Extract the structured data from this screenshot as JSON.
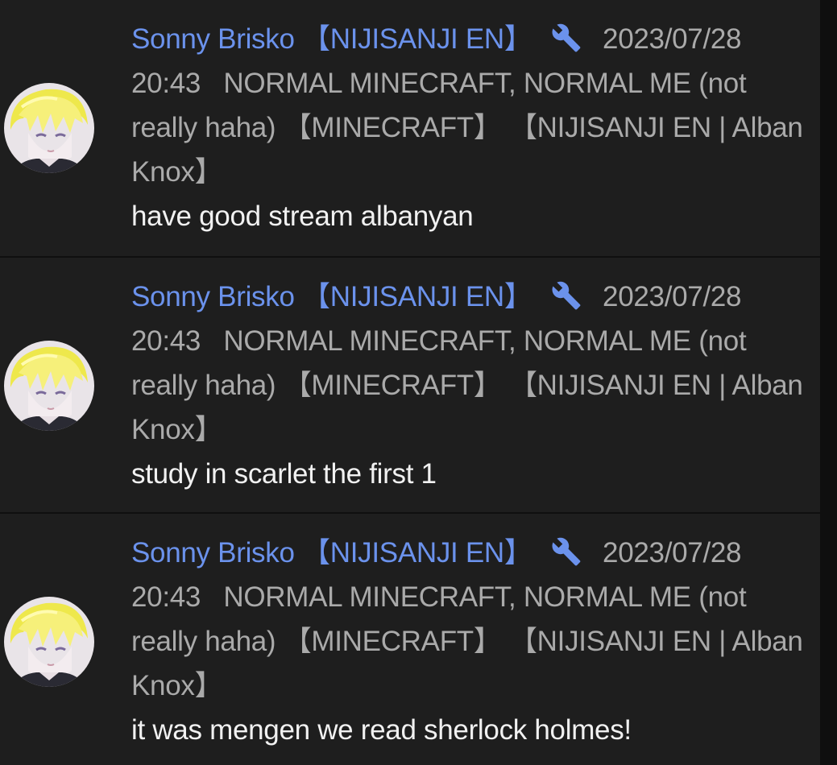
{
  "comments": [
    {
      "author": "Sonny Brisko",
      "affiliation": "【NIJISANJI EN】",
      "date": "2023/07/28",
      "time": "20:43",
      "title_line1": "NORMAL MINECRAFT, NORMAL ME (not",
      "title_line2": "really haha) 【MINECRAFT】 【NIJISANJI EN | Alban",
      "title_line3": "Knox】",
      "message": "have good stream albanyan"
    },
    {
      "author": "Sonny Brisko",
      "affiliation": "【NIJISANJI EN】",
      "date": "2023/07/28",
      "time": "20:43",
      "title_line1": "NORMAL MINECRAFT, NORMAL ME (not",
      "title_line2": "really haha) 【MINECRAFT】 【NIJISANJI EN | Alban",
      "title_line3": "Knox】",
      "message": "study in scarlet the first 1"
    },
    {
      "author": "Sonny Brisko",
      "affiliation": "【NIJISANJI EN】",
      "date": "2023/07/28",
      "time": "20:43",
      "title_line1": "NORMAL MINECRAFT, NORMAL ME (not",
      "title_line2": "really haha) 【MINECRAFT】 【NIJISANJI EN | Alban",
      "title_line3": "Knox】",
      "message": "it was mengen we read sherlock holmes!"
    }
  ],
  "icons": {
    "avatar": "avatar-image",
    "wrench": "wrench-icon"
  },
  "colors": {
    "background": "#0f0f0f",
    "card": "#1e1e1e",
    "author": "#6b92ec",
    "meta": "#aaaaaa",
    "message": "#f1f1f1"
  }
}
